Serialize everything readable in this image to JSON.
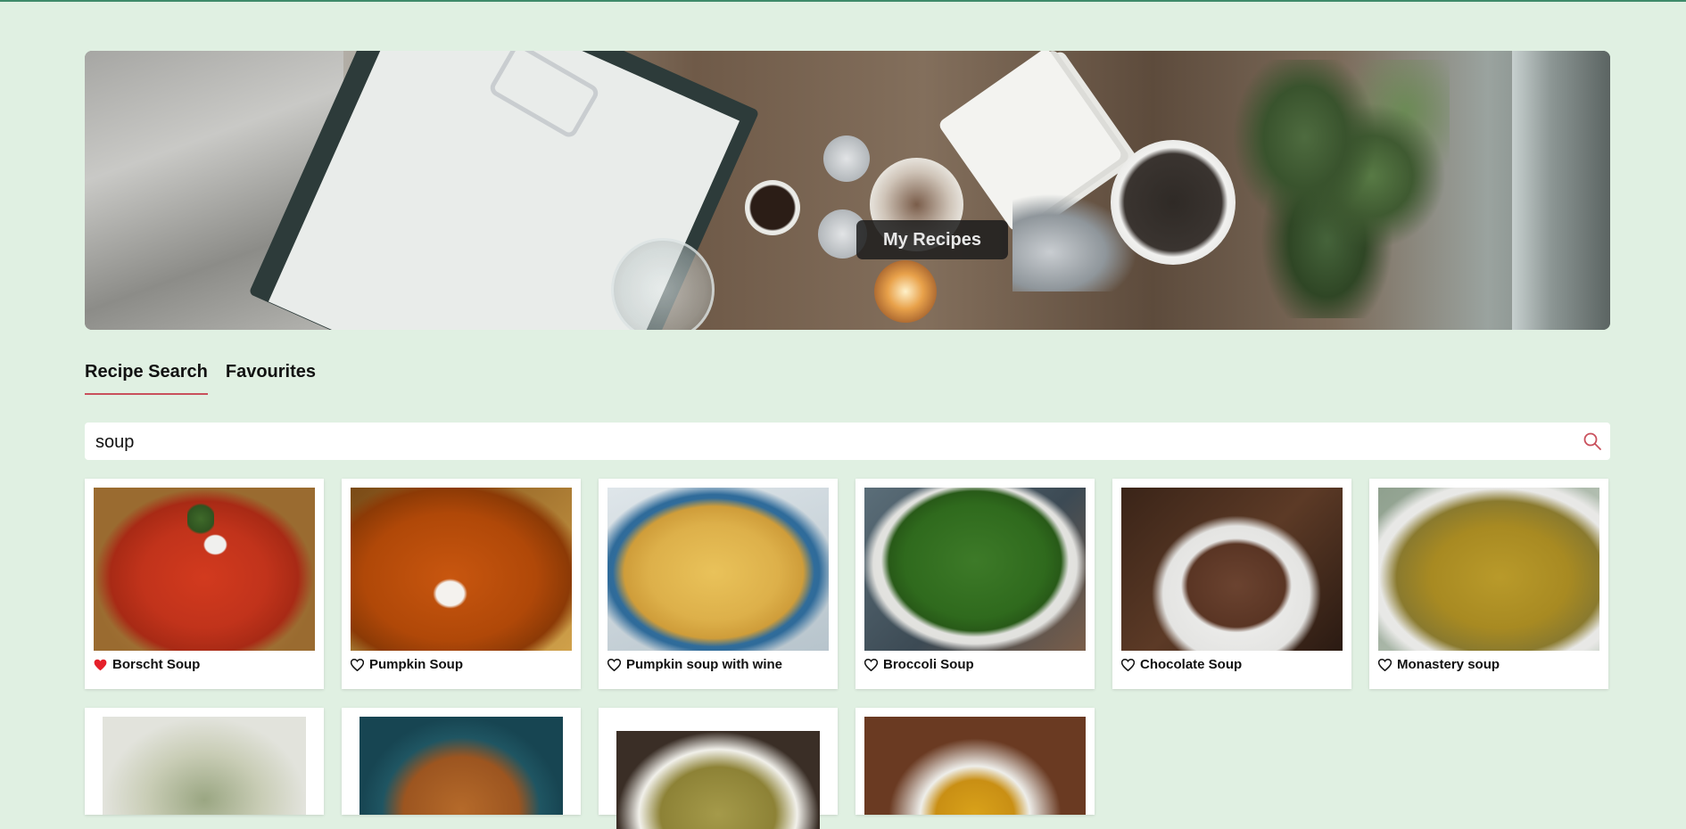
{
  "app": {
    "hero_title": "My Recipes",
    "accent_color": "#c9505c",
    "background_color": "#e0f0e2"
  },
  "tabs": [
    {
      "label": "Recipe Search",
      "active": true
    },
    {
      "label": "Favourites",
      "active": false
    }
  ],
  "search": {
    "value": "soup",
    "icon": "search-icon"
  },
  "recipes": [
    {
      "name": "Borscht Soup",
      "favourite": true
    },
    {
      "name": "Pumpkin Soup",
      "favourite": false
    },
    {
      "name": "Pumpkin soup with wine",
      "favourite": false
    },
    {
      "name": "Broccoli Soup",
      "favourite": false
    },
    {
      "name": "Chocolate Soup",
      "favourite": false
    },
    {
      "name": "Monastery soup",
      "favourite": false
    }
  ]
}
